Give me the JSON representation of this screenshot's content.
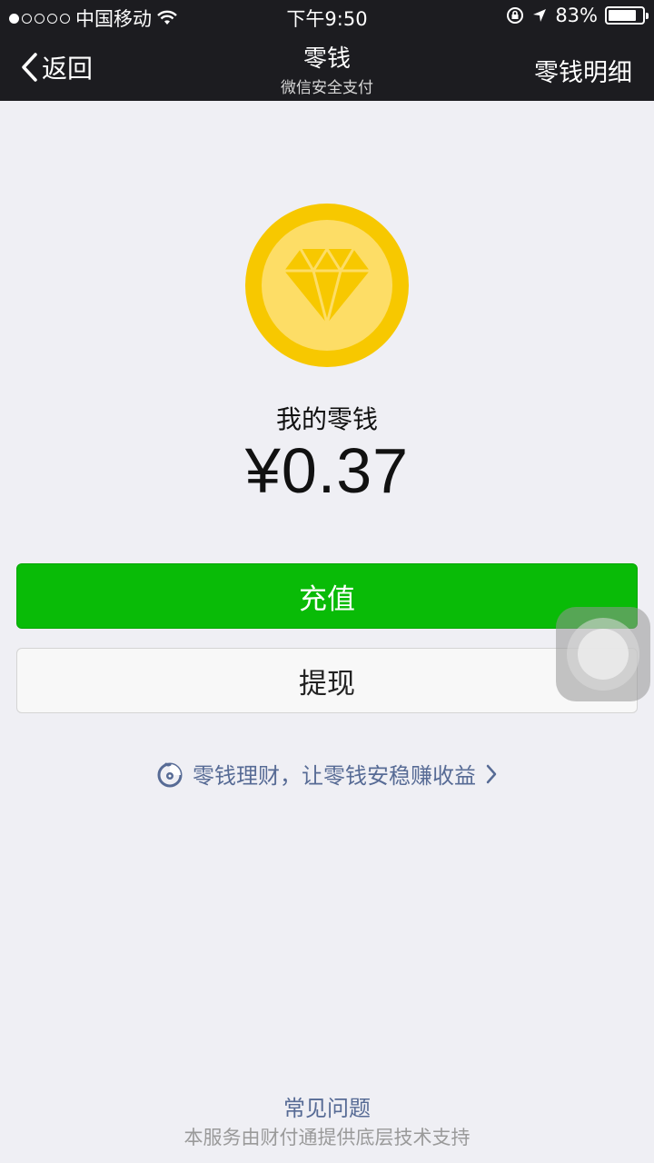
{
  "status_bar": {
    "carrier": "中国移动",
    "time": "下午9:50",
    "battery_percent": "83%",
    "battery_level": 0.83,
    "icons": [
      "signal-dots-icon",
      "wifi-icon",
      "rotation-lock-icon",
      "location-arrow-icon",
      "battery-icon"
    ]
  },
  "nav": {
    "back_label": "返回",
    "title": "零钱",
    "subtitle": "微信安全支付",
    "right_label": "零钱明细"
  },
  "balance": {
    "label": "我的零钱",
    "amount": "¥0.37"
  },
  "actions": {
    "recharge_label": "充值",
    "withdraw_label": "提现"
  },
  "promo": {
    "text": "零钱理财，让零钱安稳赚收益"
  },
  "footer": {
    "faq_label": "常见问题",
    "note": "本服务由财付通提供底层技术支持"
  },
  "colors": {
    "nav_bg": "#1c1c20",
    "page_bg": "#efeff4",
    "primary_green": "#09bb07",
    "coin_outer": "#f7c800",
    "coin_inner": "#fddd66",
    "link_blue": "#576b95"
  }
}
